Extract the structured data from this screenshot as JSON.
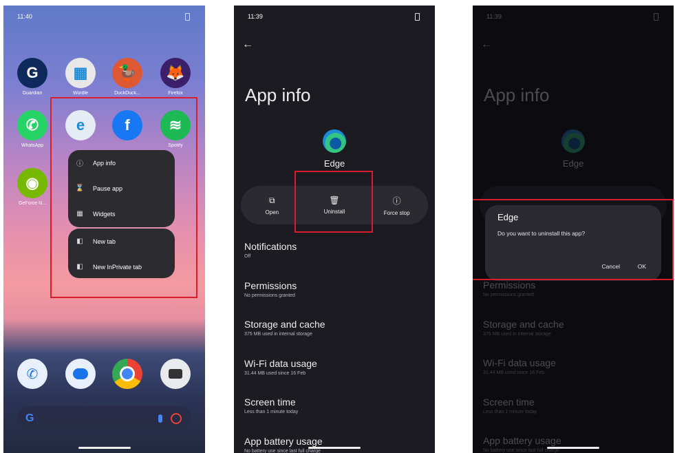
{
  "panel1": {
    "time": "11:40",
    "apps_row1": [
      {
        "label": "Guardian",
        "glyph": "G",
        "color": "#0e2a5c",
        "icon": "guardian-icon"
      },
      {
        "label": "Wordle",
        "glyph": "▦",
        "color": "#e8e8e8",
        "icon": "wordle-icon"
      },
      {
        "label": "DuckDuck...",
        "glyph": "🦆",
        "color": "#de5833",
        "icon": "duckduckgo-icon"
      },
      {
        "label": "Firefox",
        "glyph": "🦊",
        "color": "#3b1f6b",
        "icon": "firefox-icon"
      }
    ],
    "apps_row2": [
      {
        "label": "WhatsApp",
        "glyph": "✆",
        "color": "#25d366",
        "icon": "whatsapp-icon"
      },
      {
        "label": "",
        "glyph": "e",
        "color": "#e6ecf3",
        "icon": "edge-icon"
      },
      {
        "label": "",
        "glyph": "f",
        "color": "#1877f2",
        "icon": "facebook-icon"
      },
      {
        "label": "Spotify",
        "glyph": "≋",
        "color": "#1db954",
        "icon": "spotify-icon"
      }
    ],
    "apps_row3": [
      {
        "label": "GeForce N...",
        "glyph": "◉",
        "color": "#76b900",
        "icon": "geforce-icon"
      }
    ],
    "menu_group1": [
      {
        "label": "App info",
        "icon": "info-icon",
        "glyph": "ⓘ"
      },
      {
        "label": "Pause app",
        "icon": "hourglass-icon",
        "glyph": "⌛"
      },
      {
        "label": "Widgets",
        "icon": "widgets-icon",
        "glyph": "▦"
      }
    ],
    "menu_group2": [
      {
        "label": "New tab",
        "icon": "edge-newtab-icon",
        "glyph": "◧"
      },
      {
        "label": "New InPrivate tab",
        "icon": "edge-inprivate-icon",
        "glyph": "◧"
      }
    ],
    "search_glyph": "G"
  },
  "panel2": {
    "time": "11:39",
    "title": "App info",
    "app_name": "Edge",
    "actions": [
      {
        "label": "Open",
        "glyph": "⧉",
        "icon": "open-icon"
      },
      {
        "label": "Uninstall",
        "glyph": "🗑",
        "icon": "trash-icon"
      },
      {
        "label": "Force stop",
        "glyph": "ⓘ",
        "icon": "force-stop-icon"
      }
    ],
    "settings": [
      {
        "title": "Notifications",
        "subtitle": "Off"
      },
      {
        "title": "Permissions",
        "subtitle": "No permissions granted"
      },
      {
        "title": "Storage and cache",
        "subtitle": "375 MB used in internal storage"
      },
      {
        "title": "Wi-Fi data usage",
        "subtitle": "31.44 MB used since 16 Feb"
      },
      {
        "title": "Screen time",
        "subtitle": "Less than 1 minute today"
      },
      {
        "title": "App battery usage",
        "subtitle": "No battery use since last full charge"
      }
    ]
  },
  "panel3": {
    "time": "11:39",
    "title": "App info",
    "app_name": "Edge",
    "dialog": {
      "title": "Edge",
      "message": "Do you want to uninstall this app?",
      "cancel": "Cancel",
      "ok": "OK"
    },
    "settings": [
      {
        "title": "Permissions",
        "subtitle": "No permissions granted"
      },
      {
        "title": "Storage and cache",
        "subtitle": "375 MB used in internal storage"
      },
      {
        "title": "Wi-Fi data usage",
        "subtitle": "31.44 MB used since 16 Feb"
      },
      {
        "title": "Screen time",
        "subtitle": "Less than 1 minute today"
      },
      {
        "title": "App battery usage",
        "subtitle": "No battery use since last full charge"
      }
    ]
  },
  "highlight_color": "#d81e2a"
}
